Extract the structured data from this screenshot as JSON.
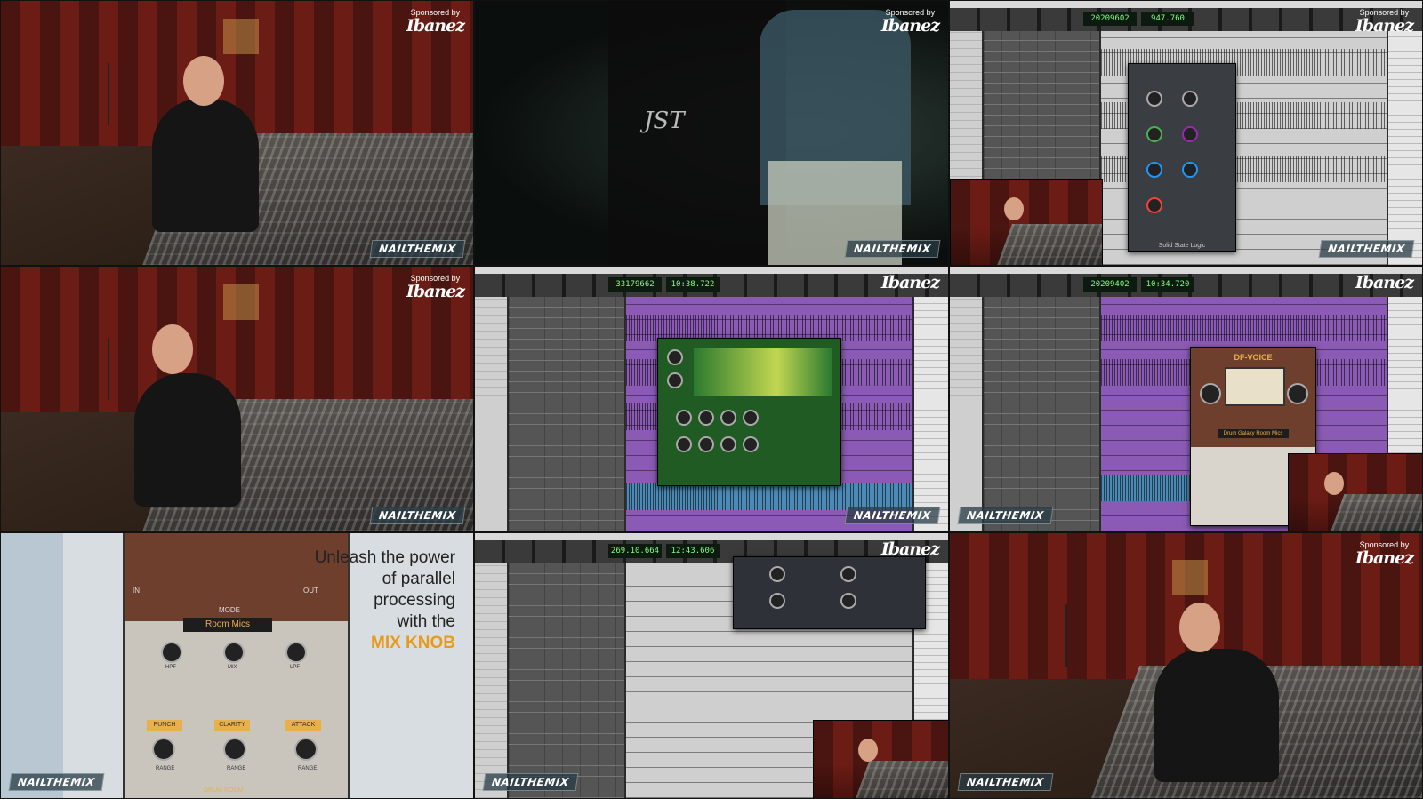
{
  "sponsor": {
    "small": "Sponsored by",
    "brand": "Ibanez"
  },
  "watermark": "NAILTHEMIX",
  "stage_shirt_text": "JST",
  "daw_counters": [
    "20209602",
    "947.760",
    "33179662",
    "10:38.722",
    "20209402",
    "10:34.720",
    "269.10.664",
    "12:43.606"
  ],
  "plugin_labels": {
    "df_voice": "DF-VOICE",
    "drum_room": "Drum Galaxy Room Mics",
    "ssl_bottom": "Solid State Logic"
  },
  "promo": {
    "line1": "Unleash the power",
    "line2": "of parallel",
    "line3": "processing",
    "line4": "with the",
    "highlight": "MIX KNOB",
    "mode_slot": "Room Mics",
    "mode_label": "MODE",
    "in_label": "IN",
    "out_label": "OUT",
    "hpf_label": "HPF",
    "mix_label": "MIX",
    "lpf_label": "LPF",
    "punch_label": "PUNCH",
    "clarity_label": "CLARITY",
    "attack_label": "ATTACK",
    "range_label": "RANGE",
    "footer_label": "DRUM ROOM"
  }
}
